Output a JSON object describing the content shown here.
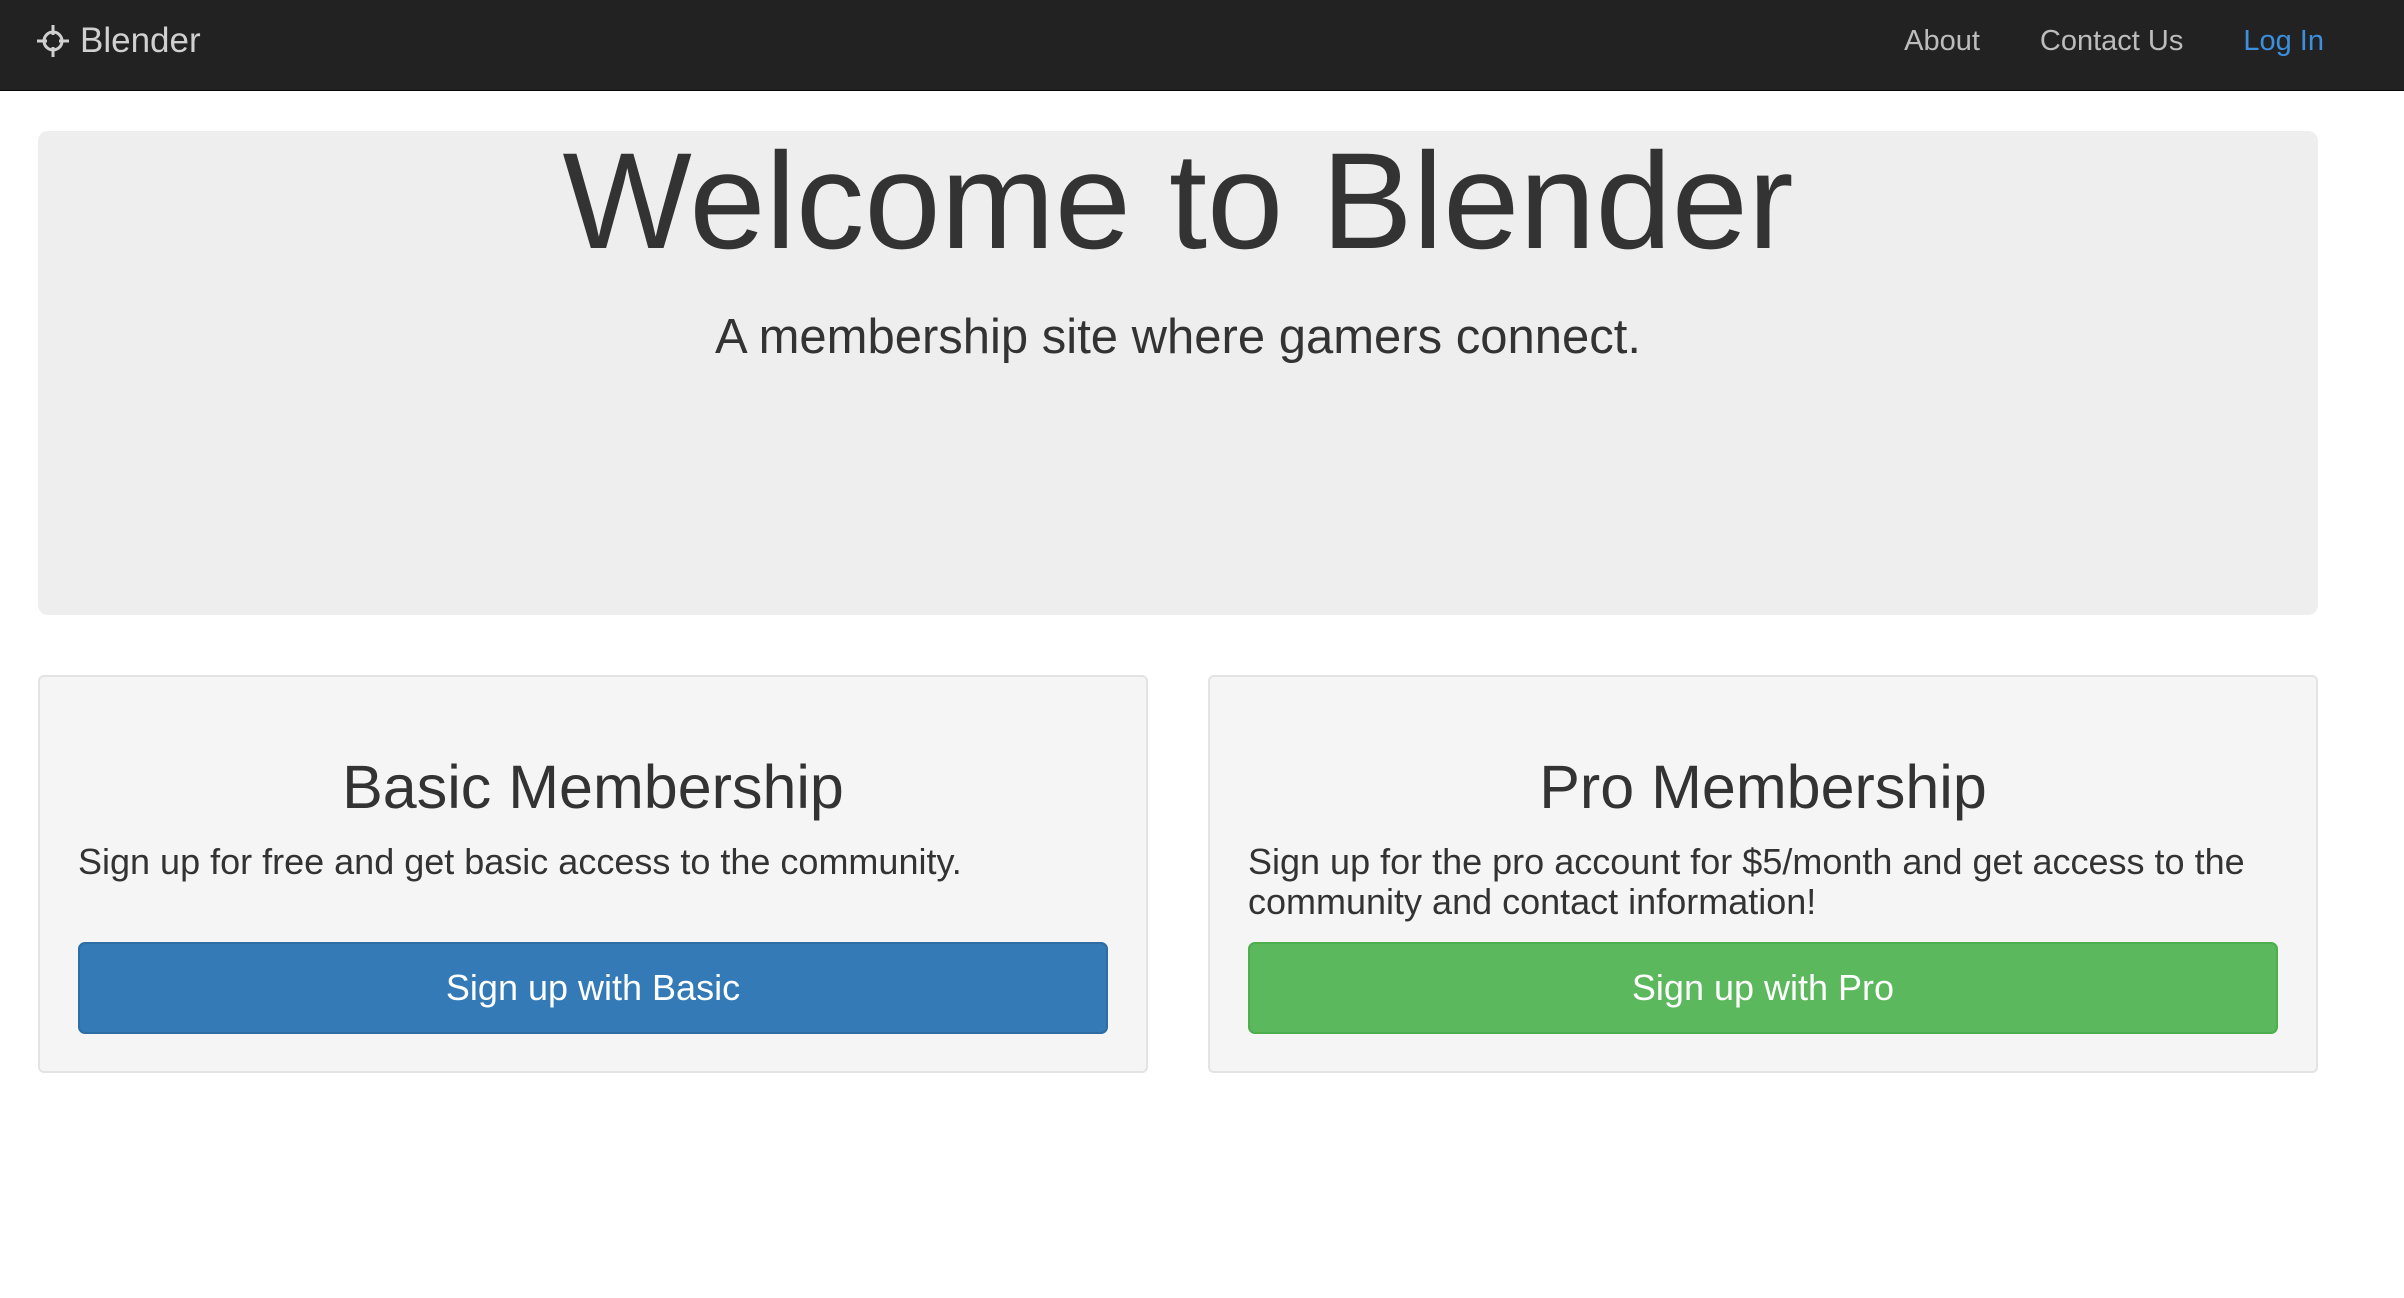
{
  "navbar": {
    "brand_icon": "crosshair-icon",
    "brand_label": "Blender",
    "links": [
      {
        "label": "About"
      },
      {
        "label": "Contact Us"
      },
      {
        "label": "Log In"
      }
    ]
  },
  "hero": {
    "title": "Welcome to Blender",
    "subtitle": "A membership site where gamers connect."
  },
  "plans": [
    {
      "title": "Basic Membership",
      "description": "Sign up for free and get basic access to the community.",
      "button_label": "Sign up with Basic"
    },
    {
      "title": "Pro Membership",
      "description": "Sign up for the pro account for $5/month and get access to the community and contact information!",
      "button_label": "Sign up with Pro"
    }
  ],
  "colors": {
    "navbar_bg": "#222222",
    "active_link": "#3c8fdc",
    "basic_button": "#337ab7",
    "pro_button": "#5cb85c",
    "jumbotron_bg": "#eeeeee",
    "card_bg": "#f5f5f5"
  }
}
